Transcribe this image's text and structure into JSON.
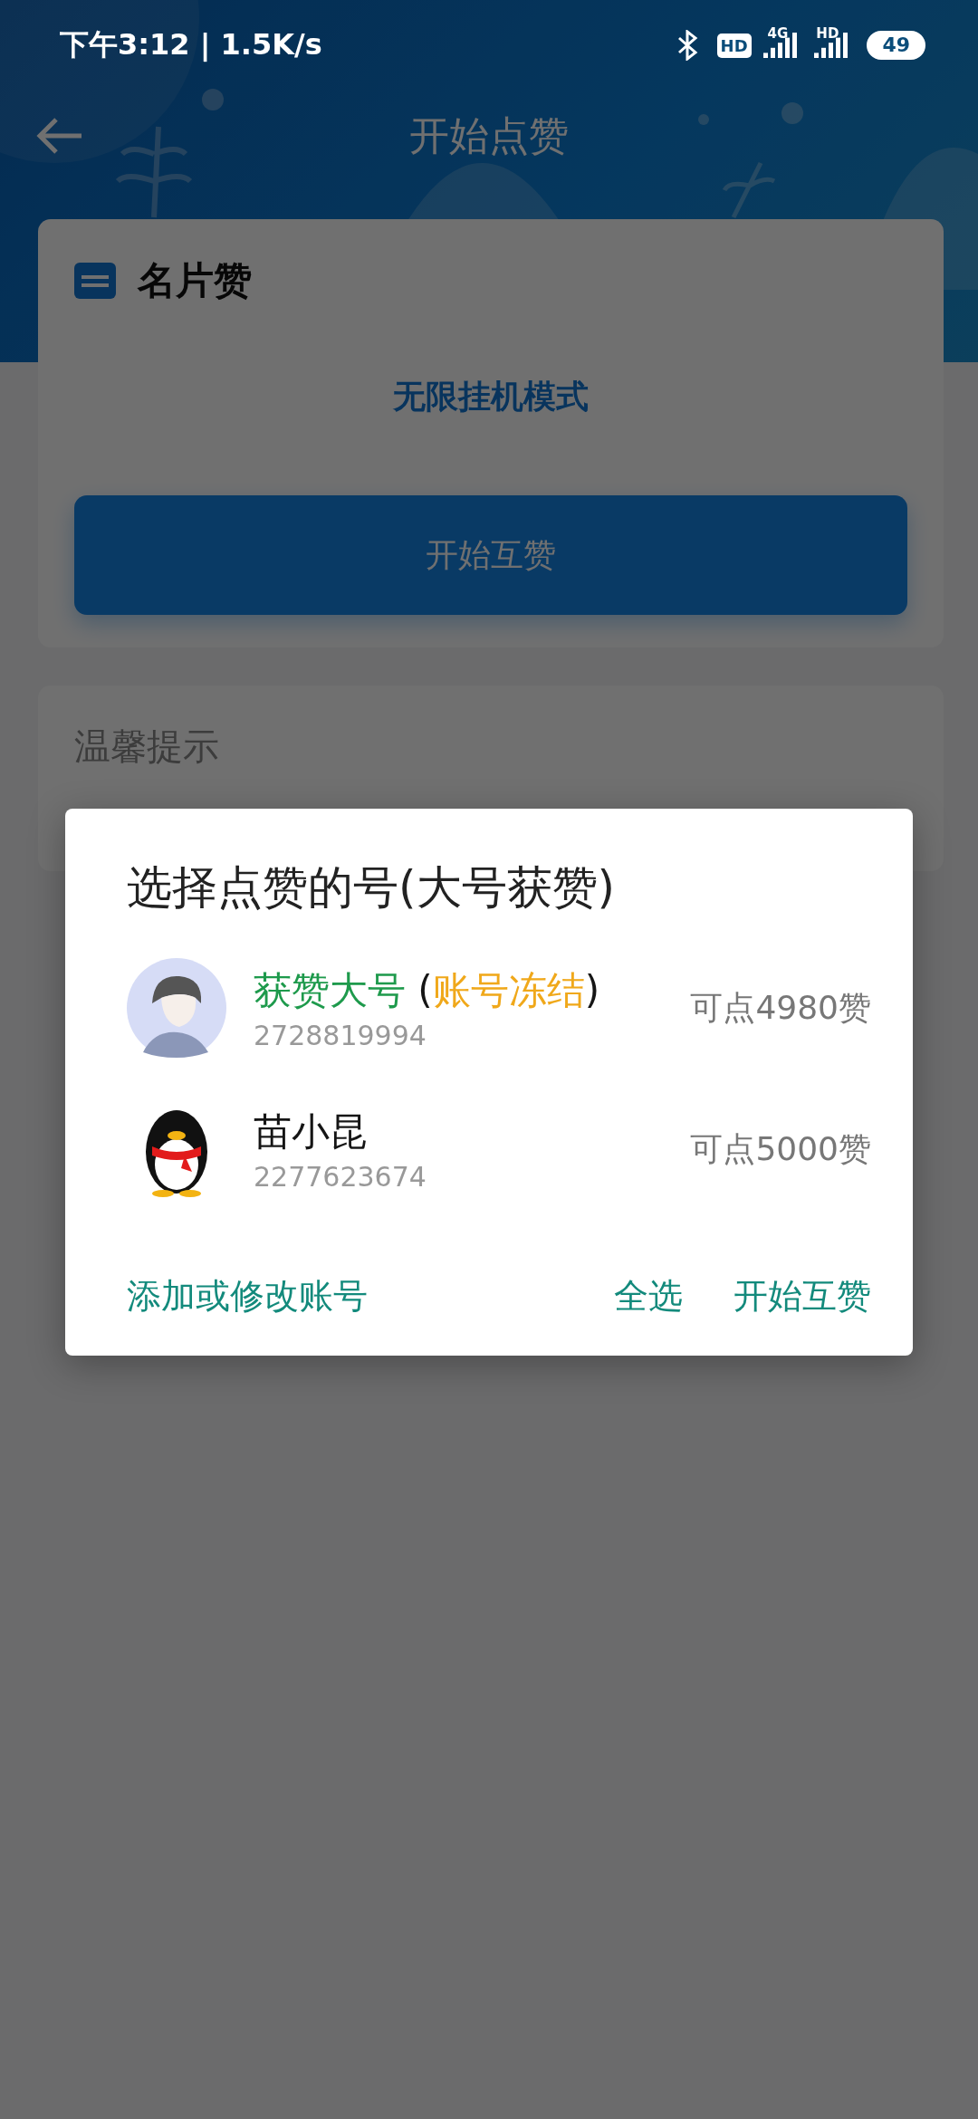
{
  "status_bar": {
    "time": "下午3:12 | 1.5K/s",
    "hd_badge": "HD",
    "sim1_label": "4G",
    "sim2_label": "HD",
    "battery": "49"
  },
  "header": {
    "title": "开始点赞"
  },
  "card": {
    "title": "名片赞",
    "mode": "无限挂机模式",
    "button": "开始互赞"
  },
  "tips": {
    "title": "温馨提示"
  },
  "dialog": {
    "title": "选择点赞的号(大号获赞)",
    "accounts": [
      {
        "kind": "person",
        "name": "获赞大号",
        "color": "#1e9a4c",
        "note": {
          "open": "(",
          "text": "账号冻结",
          "close": ")"
        },
        "id": "2728819994",
        "quota": "可点4980赞"
      },
      {
        "kind": "penguin",
        "name": "苗小昆",
        "color": "#151515",
        "id": "2277623674",
        "quota": "可点5000赞"
      }
    ],
    "actions": [
      {
        "kind": "left",
        "label": "添加或修改账号"
      },
      {
        "kind": "right",
        "label": "全选"
      },
      {
        "kind": "right",
        "label": "开始互赞"
      }
    ]
  }
}
